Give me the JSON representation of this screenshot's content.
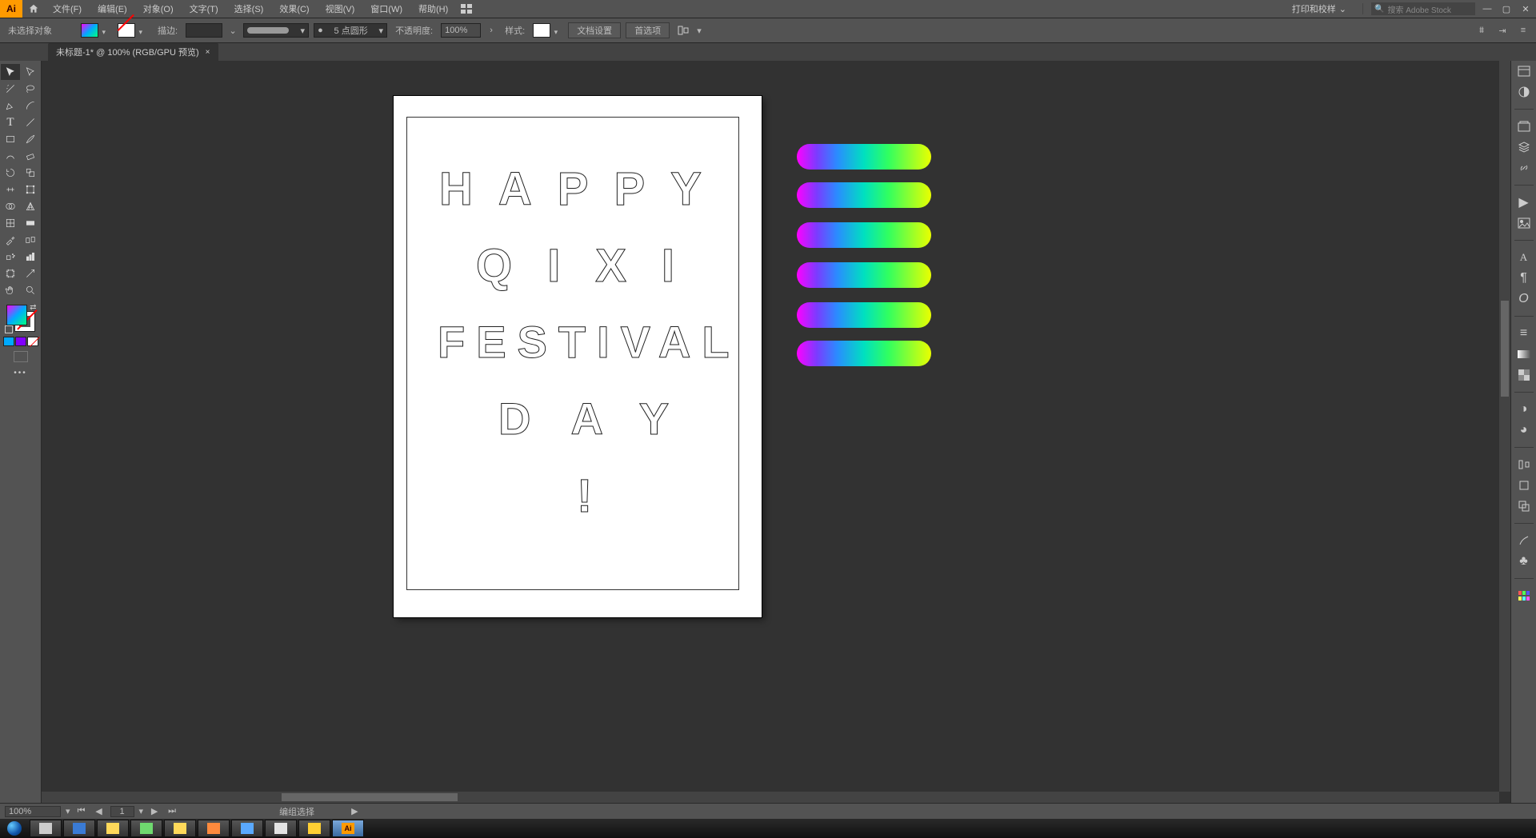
{
  "menubar": {
    "ai": "Ai",
    "items": [
      "文件(F)",
      "编辑(E)",
      "对象(O)",
      "文字(T)",
      "选择(S)",
      "效果(C)",
      "视图(V)",
      "窗口(W)",
      "帮助(H)"
    ],
    "workspace_label": "打印和校样",
    "search_placeholder": "搜索 Adobe Stock"
  },
  "controlbar": {
    "no_selection": "未选择对象",
    "stroke_label": "描边:",
    "stroke_value": "",
    "profile_label": "5 点圆形",
    "profile_bullet": "●",
    "opacity_label": "不透明度:",
    "opacity_value": "100%",
    "style_label": "样式:",
    "doc_setup": "文档设置",
    "prefs": "首选项"
  },
  "tab": {
    "title": "未标题-1* @ 100% (RGB/GPU 预览)",
    "close": "×"
  },
  "art": {
    "line1": "HAPPY",
    "line2": "QIXI",
    "line3": "FESTIVAL",
    "line4": "DAY",
    "line5": "!"
  },
  "status": {
    "zoom": "100%",
    "artboard_current": "1",
    "tool": "编组选择"
  }
}
